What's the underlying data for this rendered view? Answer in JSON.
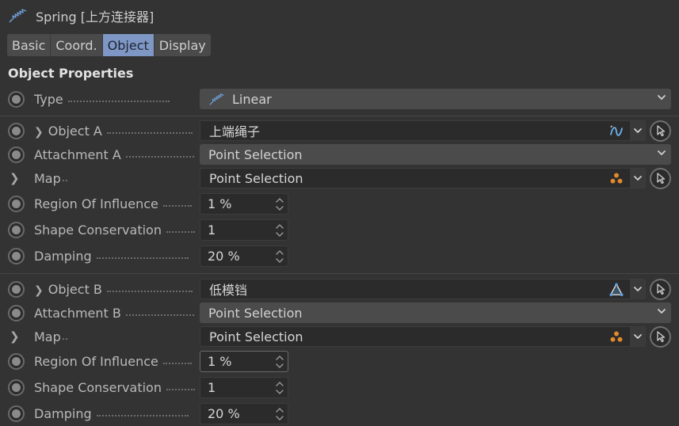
{
  "window": {
    "title": "Spring [上方连接器]",
    "logo_icon": "spring-icon"
  },
  "tabs": [
    {
      "label": "Basic",
      "active": false
    },
    {
      "label": "Coord.",
      "active": false
    },
    {
      "label": "Object",
      "active": true
    },
    {
      "label": "Display",
      "active": false
    }
  ],
  "section": {
    "title": "Object Properties"
  },
  "type": {
    "label": "Type",
    "value": "Linear",
    "icon": "spring-icon"
  },
  "groupA": {
    "object_label": "Object A",
    "object_value": "上端绳子",
    "object_icon": "spline-icon",
    "attachment_label": "Attachment A",
    "attachment_value": "Point Selection",
    "map_label": "Map",
    "map_value": "Point Selection",
    "map_icon": "point-selection-icon",
    "region_label": "Region Of Influence",
    "region_value": "1 %",
    "shape_label": "Shape Conservation",
    "shape_value": "1",
    "damping_label": "Damping",
    "damping_value": "20 %"
  },
  "groupB": {
    "object_label": "Object B",
    "object_value": "低模铛",
    "object_icon": "polygon-object-icon",
    "attachment_label": "Attachment B",
    "attachment_value": "Point Selection",
    "map_label": "Map",
    "map_value": "Point Selection",
    "map_icon": "point-selection-icon",
    "region_label": "Region Of Influence",
    "region_value": "1 %",
    "shape_label": "Shape Conservation",
    "shape_value": "1",
    "damping_label": "Damping",
    "damping_value": "20 %"
  },
  "colors": {
    "background": "#333333",
    "active_tab": "#7f97c4",
    "field_bg": "#2b2b2b",
    "dropdown_bg": "#4b4b4b",
    "accent_orange": "#e08a2c",
    "accent_blue": "#5aa0e0"
  }
}
